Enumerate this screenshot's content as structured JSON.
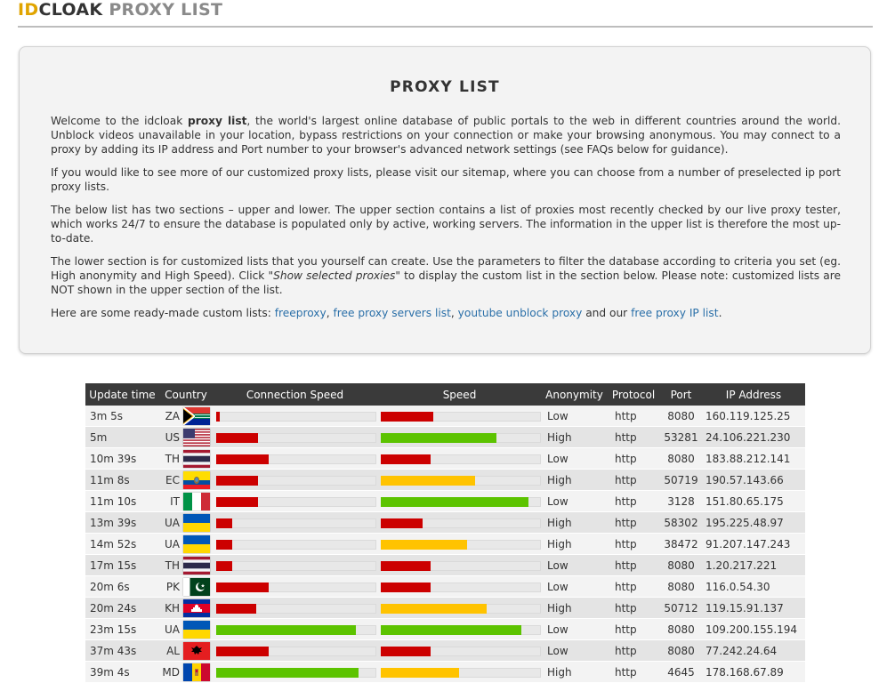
{
  "header": {
    "title_part1": "ID",
    "title_part2": "CLOAK",
    "title_part3": "PROXY LIST"
  },
  "intro": {
    "heading": "PROXY LIST",
    "p1_a": "Welcome to the idcloak ",
    "p1_bold": "proxy list",
    "p1_b": ", the world's largest online database of public portals to the web in different countries around the world. Unblock videos unavailable in your location, bypass restrictions on your connection or make your browsing anonymous. You may connect to a proxy by adding its IP address and Port number to your browser's advanced network settings (see FAQs below for guidance).",
    "p2": "If you would like to see more of our customized proxy lists, please visit our sitemap, where you can choose from a number of preselected ip port proxy lists.",
    "p3": "The below list has two sections – upper and lower. The upper section contains a list of proxies most recently checked by our live proxy tester, which works 24/7 to ensure the database is populated only by active, working servers. The information in the upper list is therefore the most up-to-date.",
    "p4_a": "The lower section is for customized lists that you yourself can create. Use the parameters to filter the database according to criteria you set (eg. High anonymity and High Speed). Click ",
    "p4_italic": "\"Show selected proxies\"",
    "p4_b": " to display the custom list in the section below. Please note: customized lists are NOT shown in the upper section of the list.",
    "p5_a": "Here are some ready-made custom lists: ",
    "link1": "freeproxy",
    "sep1": ", ",
    "link2": "free proxy servers list",
    "sep2": ", ",
    "link3": "youtube unblock proxy",
    "p5_mid": " and our ",
    "link4": "free proxy IP list",
    "p5_end": "."
  },
  "table": {
    "headers": [
      "Update time",
      "Country",
      "Connection Speed",
      "Speed",
      "Anonymity",
      "Protocol",
      "Port",
      "IP Address"
    ],
    "rows": [
      {
        "time": "3m 5s",
        "cc": "ZA",
        "flag": "za-flag-icon",
        "conn": 0.02,
        "conn_color": "red",
        "speed": 0.33,
        "speed_color": "red",
        "anon": "Low",
        "proto": "http",
        "port": "8080",
        "ip": "160.119.125.25"
      },
      {
        "time": "5m",
        "cc": "US",
        "flag": "us-flag-icon",
        "conn": 0.26,
        "conn_color": "red",
        "speed": 0.72,
        "speed_color": "green",
        "anon": "High",
        "proto": "http",
        "port": "53281",
        "ip": "24.106.221.230"
      },
      {
        "time": "10m 39s",
        "cc": "TH",
        "flag": "th-flag-icon",
        "conn": 0.33,
        "conn_color": "red",
        "speed": 0.31,
        "speed_color": "red",
        "anon": "Low",
        "proto": "http",
        "port": "8080",
        "ip": "183.88.212.141"
      },
      {
        "time": "11m 8s",
        "cc": "EC",
        "flag": "ec-flag-icon",
        "conn": 0.26,
        "conn_color": "red",
        "speed": 0.59,
        "speed_color": "yellow",
        "anon": "High",
        "proto": "http",
        "port": "50719",
        "ip": "190.57.143.66"
      },
      {
        "time": "11m 10s",
        "cc": "IT",
        "flag": "it-flag-icon",
        "conn": 0.26,
        "conn_color": "red",
        "speed": 0.92,
        "speed_color": "green",
        "anon": "Low",
        "proto": "http",
        "port": "3128",
        "ip": "151.80.65.175"
      },
      {
        "time": "13m 39s",
        "cc": "UA",
        "flag": "ua-flag-icon",
        "conn": 0.1,
        "conn_color": "red",
        "speed": 0.26,
        "speed_color": "red",
        "anon": "High",
        "proto": "http",
        "port": "58302",
        "ip": "195.225.48.97"
      },
      {
        "time": "14m 52s",
        "cc": "UA",
        "flag": "ua-flag-icon",
        "conn": 0.1,
        "conn_color": "red",
        "speed": 0.54,
        "speed_color": "yellow",
        "anon": "High",
        "proto": "http",
        "port": "38472",
        "ip": "91.207.147.243"
      },
      {
        "time": "17m 15s",
        "cc": "TH",
        "flag": "th-flag-icon",
        "conn": 0.1,
        "conn_color": "red",
        "speed": 0.31,
        "speed_color": "red",
        "anon": "Low",
        "proto": "http",
        "port": "8080",
        "ip": "1.20.217.221"
      },
      {
        "time": "20m 6s",
        "cc": "PK",
        "flag": "pk-flag-icon",
        "conn": 0.33,
        "conn_color": "red",
        "speed": 0.31,
        "speed_color": "red",
        "anon": "Low",
        "proto": "http",
        "port": "8080",
        "ip": "116.0.54.30"
      },
      {
        "time": "20m 24s",
        "cc": "KH",
        "flag": "kh-flag-icon",
        "conn": 0.25,
        "conn_color": "red",
        "speed": 0.66,
        "speed_color": "yellow",
        "anon": "High",
        "proto": "http",
        "port": "50712",
        "ip": "119.15.91.137"
      },
      {
        "time": "23m 15s",
        "cc": "UA",
        "flag": "ua-flag-icon",
        "conn": 0.87,
        "conn_color": "green",
        "speed": 0.88,
        "speed_color": "green",
        "anon": "Low",
        "proto": "http",
        "port": "8080",
        "ip": "109.200.155.194"
      },
      {
        "time": "37m 43s",
        "cc": "AL",
        "flag": "al-flag-icon",
        "conn": 0.33,
        "conn_color": "red",
        "speed": 0.31,
        "speed_color": "red",
        "anon": "Low",
        "proto": "http",
        "port": "8080",
        "ip": "77.242.24.64"
      },
      {
        "time": "39m 4s",
        "cc": "MD",
        "flag": "md-flag-icon",
        "conn": 0.89,
        "conn_color": "green",
        "speed": 0.49,
        "speed_color": "yellow",
        "anon": "High",
        "proto": "http",
        "port": "4645",
        "ip": "178.168.67.89"
      }
    ]
  }
}
